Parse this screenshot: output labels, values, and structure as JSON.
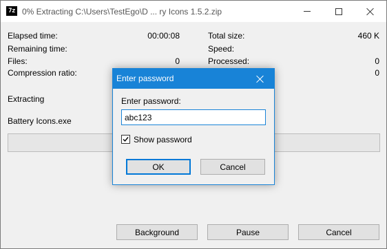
{
  "window": {
    "title": "0% Extracting C:\\Users\\TestEgo\\D ... ry Icons 1.5.2.zip",
    "app_icon_text": "7z"
  },
  "stats": {
    "elapsed_label": "Elapsed time:",
    "elapsed_value": "00:00:08",
    "remaining_label": "Remaining time:",
    "remaining_value": "",
    "files_label": "Files:",
    "files_value": "0",
    "ratio_label": "Compression ratio:",
    "ratio_value": "",
    "total_label": "Total size:",
    "total_value": "460 K",
    "speed_label": "Speed:",
    "speed_value": "",
    "processed_label": "Processed:",
    "processed_value": "0",
    "packed_value": "0"
  },
  "status": {
    "action": "Extracting",
    "current_file": "Battery Icons.exe",
    "progress_fraction": 0
  },
  "buttons": {
    "background": "Background",
    "pause": "Pause",
    "cancel": "Cancel"
  },
  "dialog": {
    "title": "Enter password",
    "prompt": "Enter password:",
    "password_value": "abc123",
    "show_password_label": "Show password",
    "show_password_checked": true,
    "ok": "OK",
    "cancel": "Cancel"
  }
}
